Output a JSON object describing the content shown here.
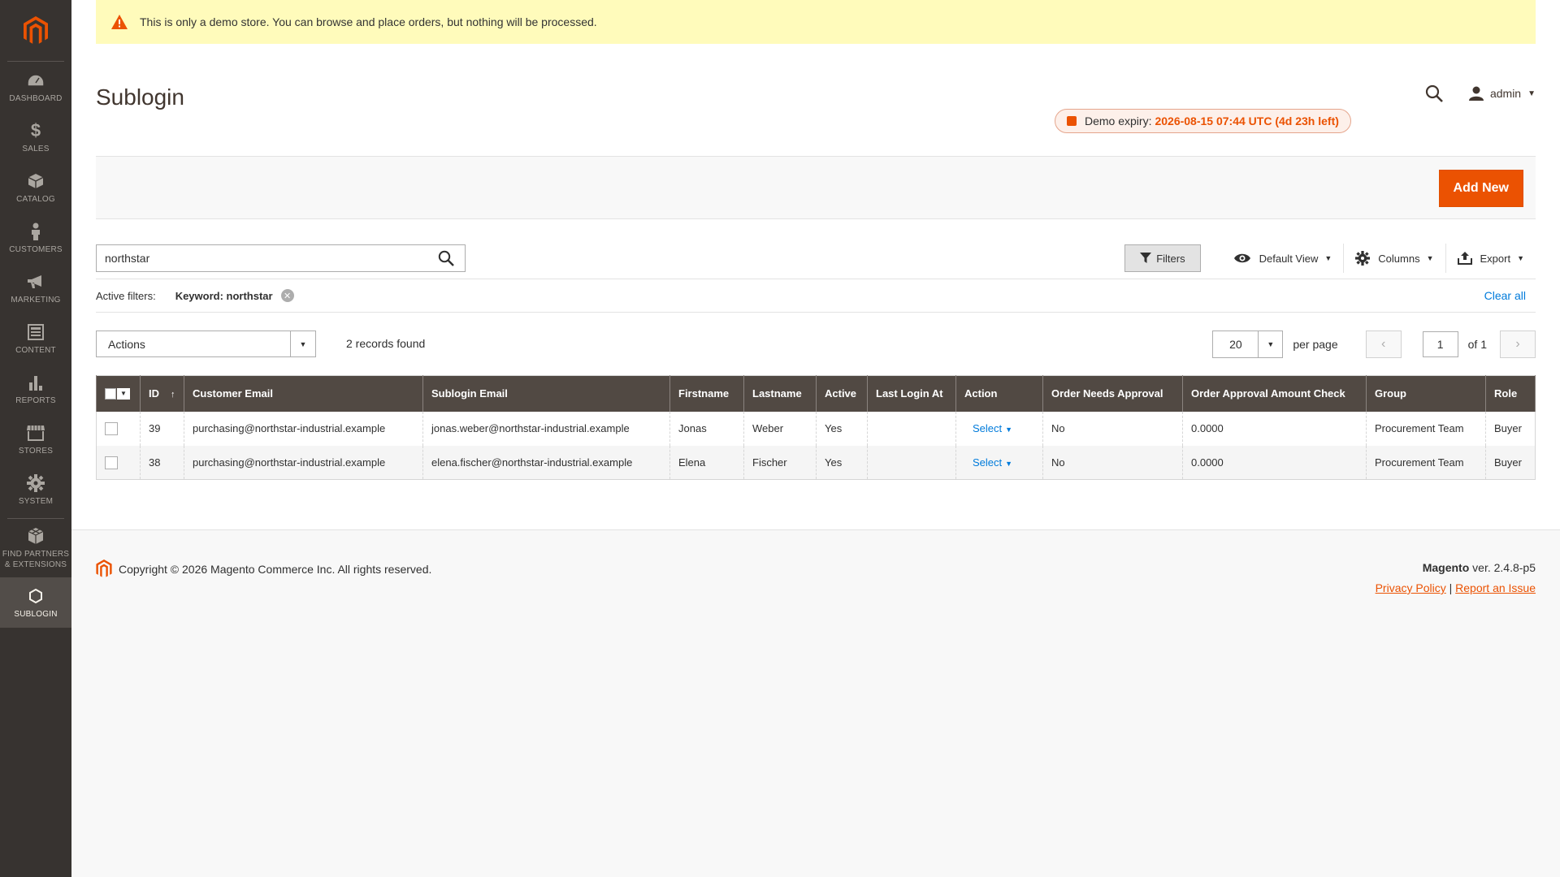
{
  "notice": {
    "text": "This is only a demo store. You can browse and place orders, but nothing will be processed."
  },
  "sidebar": {
    "items": [
      {
        "label": "DASHBOARD",
        "icon": "dashboard-icon"
      },
      {
        "label": "SALES",
        "icon": "dollar-icon"
      },
      {
        "label": "CATALOG",
        "icon": "box-icon"
      },
      {
        "label": "CUSTOMERS",
        "icon": "person-icon"
      },
      {
        "label": "MARKETING",
        "icon": "megaphone-icon"
      },
      {
        "label": "CONTENT",
        "icon": "layout-icon"
      },
      {
        "label": "REPORTS",
        "icon": "bar-chart-icon"
      },
      {
        "label": "STORES",
        "icon": "store-icon"
      },
      {
        "label": "SYSTEM",
        "icon": "gear-icon"
      }
    ],
    "partners": {
      "line1": "FIND PARTNERS",
      "line2": "& EXTENSIONS"
    },
    "active": {
      "label": "SUBLOGIN"
    }
  },
  "header": {
    "title": "Sublogin",
    "user": "admin"
  },
  "demo_expiry": {
    "label": "Demo expiry:",
    "value": "2026-08-15 07:44 UTC (4d 23h left)"
  },
  "action_bar": {
    "add_new": "Add New"
  },
  "grid_search": {
    "value": "northstar"
  },
  "toolbar": {
    "filters": "Filters",
    "view": "Default View",
    "columns": "Columns",
    "export": "Export"
  },
  "active_filters": {
    "label": "Active filters:",
    "chip": "Keyword: northstar",
    "clear_all": "Clear all"
  },
  "mass_actions": {
    "label": "Actions"
  },
  "records_found": "2 records found",
  "pager": {
    "per_page_value": "20",
    "per_page_label": "per page",
    "page": "1",
    "of": "of 1"
  },
  "table": {
    "columns": [
      "ID",
      "Customer Email",
      "Sublogin Email",
      "Firstname",
      "Lastname",
      "Active",
      "Last Login At",
      "Action",
      "Order Needs Approval",
      "Order Approval Amount Check",
      "Group",
      "Role"
    ],
    "rows": [
      {
        "id": "39",
        "customer_email": "purchasing@northstar-industrial.example",
        "sublogin_email": "jonas.weber@northstar-industrial.example",
        "firstname": "Jonas",
        "lastname": "Weber",
        "active": "Yes",
        "last_login": "",
        "action": "Select",
        "needs_approval": "No",
        "amount_check": "0.0000",
        "group": "Procurement Team",
        "role": "Buyer"
      },
      {
        "id": "38",
        "customer_email": "purchasing@northstar-industrial.example",
        "sublogin_email": "elena.fischer@northstar-industrial.example",
        "firstname": "Elena",
        "lastname": "Fischer",
        "active": "Yes",
        "last_login": "",
        "action": "Select",
        "needs_approval": "No",
        "amount_check": "0.0000",
        "group": "Procurement Team",
        "role": "Buyer"
      }
    ]
  },
  "footer": {
    "copyright": "Copyright © 2026 Magento Commerce Inc. All rights reserved.",
    "brand": "Magento",
    "version": "ver. 2.4.8-p5",
    "privacy": "Privacy Policy",
    "separator": "|",
    "report": "Report an Issue"
  },
  "colors": {
    "accent": "#eb5202",
    "sidebar_bg": "#373330",
    "table_header": "#514943",
    "link": "#007bdb",
    "notice_bg": "#fffbbb"
  }
}
